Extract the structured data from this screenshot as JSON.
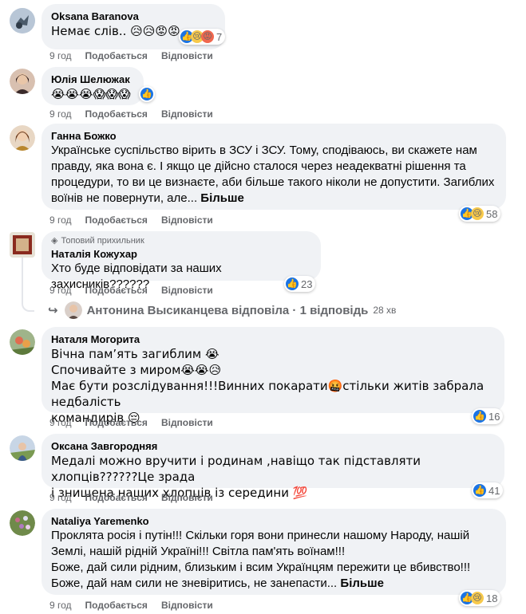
{
  "comments": [
    {
      "author": "Oksana Baranova",
      "text_lines": [
        "Немає слів.. 😥😥😡😡"
      ],
      "time": "9 год",
      "like_label": "Подобається",
      "reply_label": "Відповісти",
      "reactions": {
        "icons": [
          "like",
          "sad",
          "angry"
        ],
        "count": "7"
      }
    },
    {
      "author": "Юлія Шелюжак",
      "text_lines": [
        "😭😭😭😱😱😱"
      ],
      "time": "9 год",
      "like_label": "Подобається",
      "reply_label": "Відповісти",
      "reactions": {
        "icons": [
          "like"
        ],
        "count": ""
      }
    },
    {
      "author": "Ганна Божко",
      "text_lines": [
        "Українське суспільство вірить в ЗСУ і ЗСУ. Тому, сподіваюсь, ви скажете нам",
        "правду, яка вона є. І якщо це дійсно сталося через неадекватні рішення та",
        "процедури, то ви це визнаєте, аби більше такого ніколи не допустити. Загиблих",
        "воїнів не повернути, але..."
      ],
      "more": "Більше",
      "time": "9 год",
      "like_label": "Подобається",
      "reply_label": "Відповісти",
      "reactions": {
        "icons": [
          "like",
          "sad"
        ],
        "count": "58"
      }
    },
    {
      "badge": "Топовий прихильник",
      "author": "Наталія Кожухар",
      "text_lines": [
        "Хто буде відповідати за наших захисників??????"
      ],
      "time": "9 год",
      "like_label": "Подобається",
      "reply_label": "Відповісти",
      "reactions": {
        "icons": [
          "like"
        ],
        "count": "23"
      },
      "reply_summary": {
        "text": "Антонина Высиканцева відповіла · 1 відповідь",
        "time": "28 хв"
      }
    },
    {
      "author": "Наталя Могорита",
      "text_lines": [
        "Вічна пам’ять загиблим 😭",
        "Спочивайте з миром😭😭😥",
        "Має бути розслідування!!!Винних покарати🤬стільки житів забрала недбалість",
        "командирів 😔"
      ],
      "time": "9 год",
      "like_label": "Подобається",
      "reply_label": "Відповісти",
      "reactions": {
        "icons": [
          "like"
        ],
        "count": "16"
      }
    },
    {
      "author": "Оксана Завгородняя",
      "text_lines": [
        "Медалі можно вручити і родинам ,навіщо так підставляти хлопців??????Це зрада",
        "і знищена наших хлопців із середини 💯"
      ],
      "time": "9 год",
      "like_label": "Подобається",
      "reply_label": "Відповісти",
      "reactions": {
        "icons": [
          "like"
        ],
        "count": "41"
      }
    },
    {
      "author": "Nataliya Yaremenko",
      "text_lines": [
        "Проклята росія і путін!!! Скільки горя вони принесли нашому Народу, нашій",
        "Землі, нашій рідній Україні!!! Світла пам'ять воїнам!!!",
        "Боже, дай сили рідним, близьким і всим Українцям пережити це вбивство!!!",
        "Боже, дай нам сили не зневіритись, не занепасти..."
      ],
      "more": "Більше",
      "time": "9 год",
      "like_label": "Подобається",
      "reply_label": "Відповісти",
      "reactions": {
        "icons": [
          "like",
          "sad"
        ],
        "count": "18"
      }
    }
  ],
  "colors": {
    "bubble": "#f0f2f5",
    "meta": "#65676b",
    "like": "#1b74e4"
  }
}
